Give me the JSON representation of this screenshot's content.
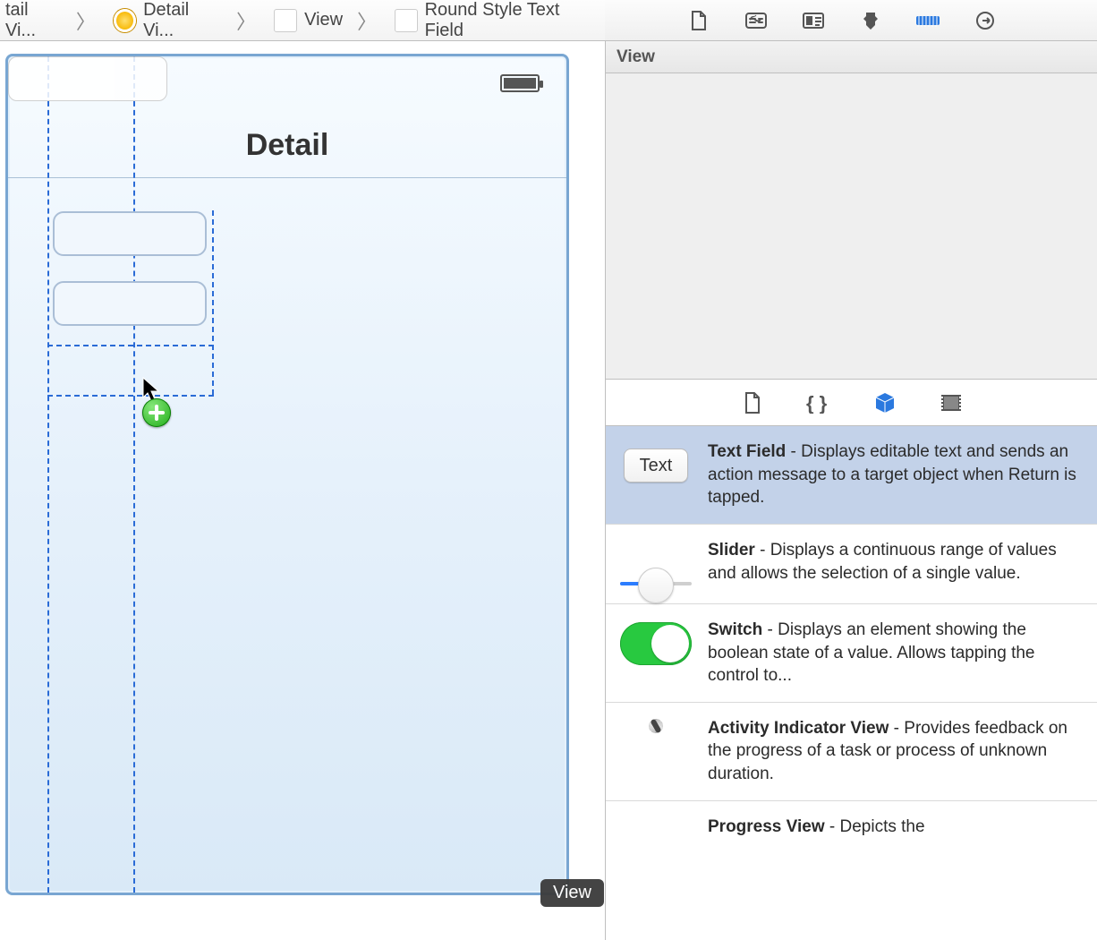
{
  "breadcrumb": {
    "items": [
      {
        "label": "tail Vi..."
      },
      {
        "label": "Detail Vi..."
      },
      {
        "label": "View"
      },
      {
        "label": "Round Style Text Field"
      }
    ]
  },
  "inspector_icons": [
    "file-inspector-icon",
    "quick-help-icon",
    "identity-inspector-icon",
    "attributes-inspector-icon",
    "size-inspector-icon",
    "connections-inspector-icon"
  ],
  "canvas": {
    "nav_title": "Detail",
    "hover_badge": "View"
  },
  "rightpane": {
    "header": "View",
    "mini_tabs": [
      "file-template-icon",
      "code-snippet-icon",
      "object-library-icon",
      "media-library-icon"
    ],
    "library": [
      {
        "thumb_label": "Text",
        "title": "Text Field",
        "desc": " - Displays editable text and sends an action message to a target object when Return is tapped."
      },
      {
        "thumb_label": "",
        "title": "Slider",
        "desc": " - Displays a continuous range of values and allows the selection of a single value."
      },
      {
        "thumb_label": "",
        "title": "Switch",
        "desc": " - Displays an element showing the boolean state of a value. Allows tapping the control to..."
      },
      {
        "thumb_label": "",
        "title": "Activity Indicator View",
        "desc": " - Provides feedback on the progress of a task or process of unknown duration."
      },
      {
        "thumb_label": "",
        "title": "Progress View",
        "desc": " - Depicts the"
      }
    ]
  }
}
